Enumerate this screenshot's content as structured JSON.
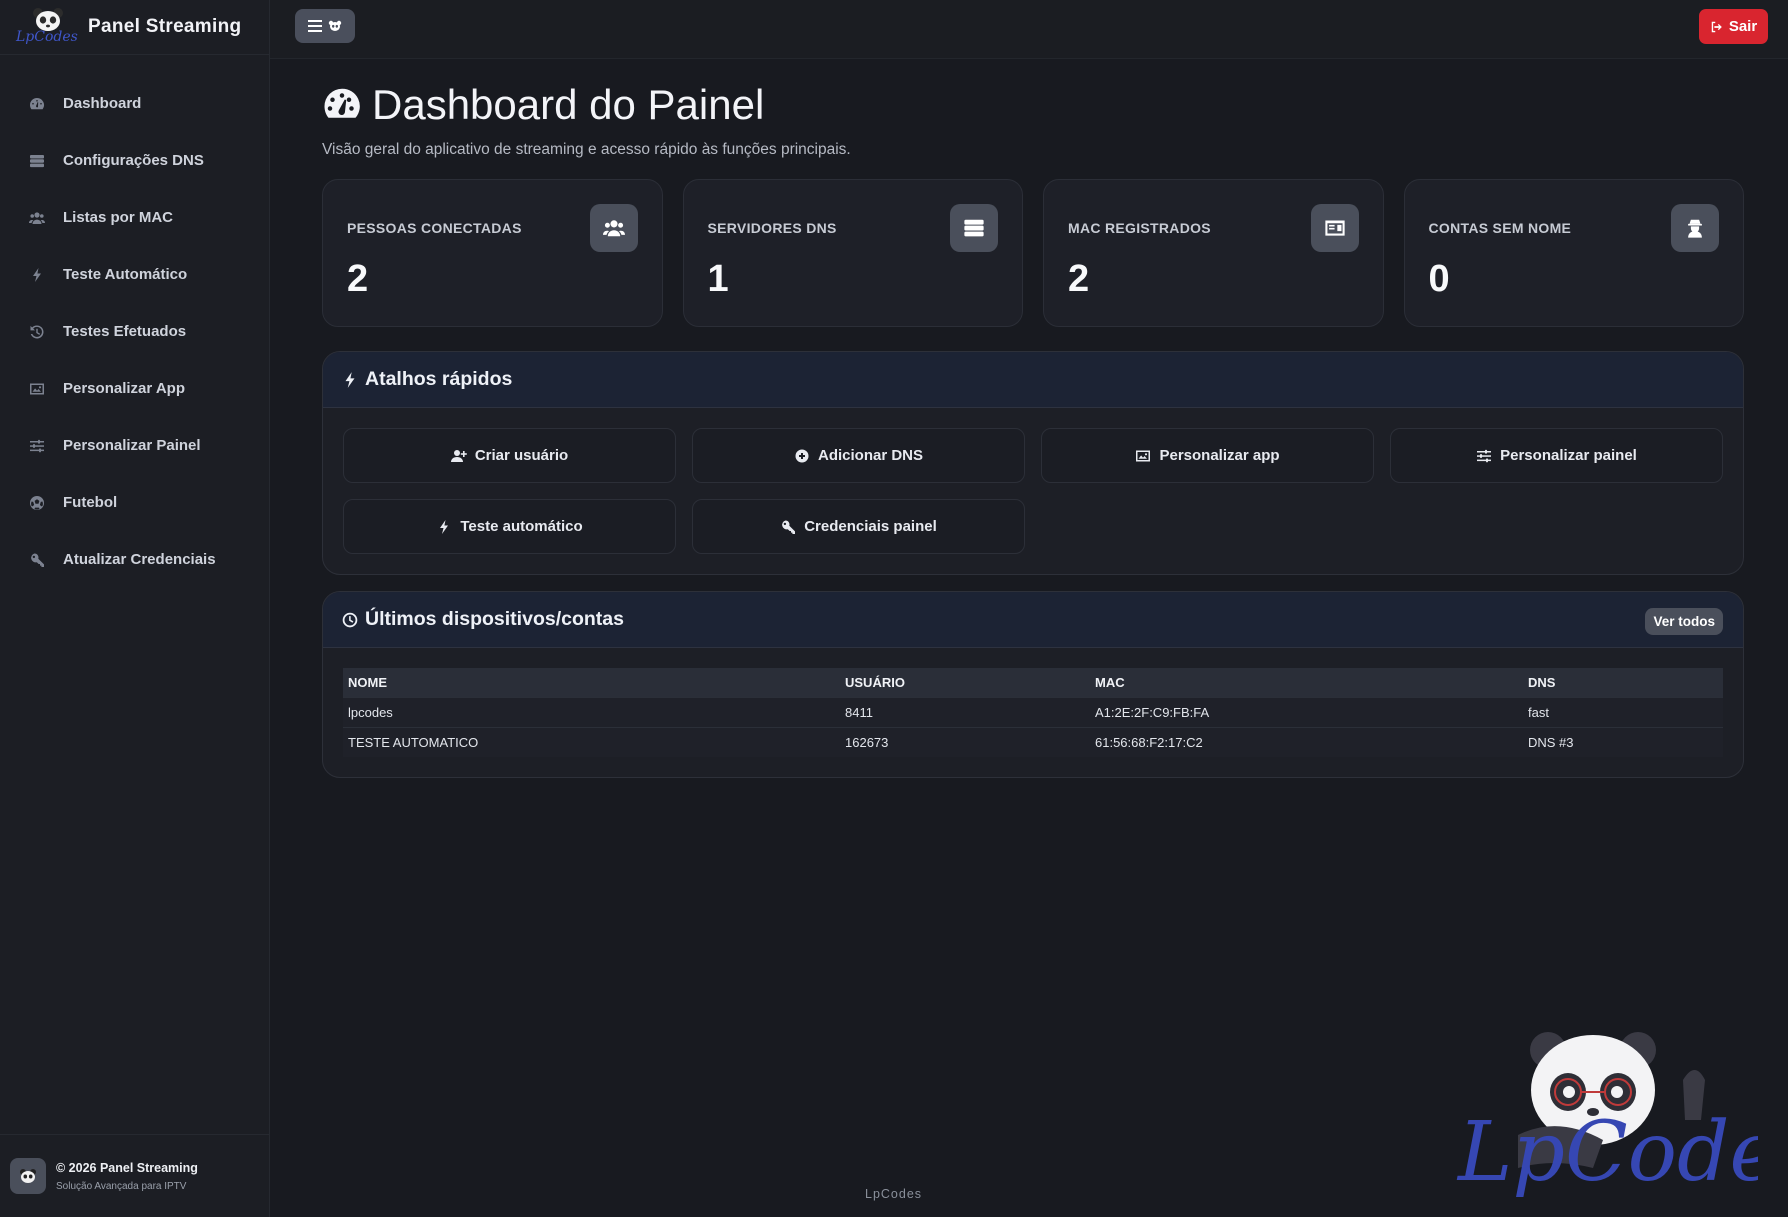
{
  "brand": {
    "logo_text": "LpCodes",
    "title": "Panel Streaming"
  },
  "sidebar": {
    "items": [
      {
        "label": "Dashboard",
        "icon": "gauge-icon"
      },
      {
        "label": "Configurações DNS",
        "icon": "server-icon"
      },
      {
        "label": "Listas por MAC",
        "icon": "users-icon"
      },
      {
        "label": "Teste Automático",
        "icon": "bolt-icon"
      },
      {
        "label": "Testes Efetuados",
        "icon": "history-icon"
      },
      {
        "label": "Personalizar App",
        "icon": "image-icon"
      },
      {
        "label": "Personalizar Painel",
        "icon": "sliders-icon"
      },
      {
        "label": "Futebol",
        "icon": "soccer-ball-icon"
      },
      {
        "label": "Atualizar Credenciais",
        "icon": "key-icon"
      }
    ],
    "footer": {
      "copyright": "© 2026 Panel Streaming",
      "tagline": "Solução Avançada para IPTV"
    }
  },
  "topbar": {
    "logout_label": "Sair"
  },
  "page": {
    "title": "Dashboard do Painel",
    "subtitle": "Visão geral do aplicativo de streaming e acesso rápido às funções principais."
  },
  "stats": [
    {
      "label": "PESSOAS CONECTADAS",
      "value": "2",
      "icon": "users-icon"
    },
    {
      "label": "SERVIDORES DNS",
      "value": "1",
      "icon": "server-icon"
    },
    {
      "label": "MAC REGISTRADOS",
      "value": "2",
      "icon": "id-card-icon"
    },
    {
      "label": "CONTAS SEM NOME",
      "value": "0",
      "icon": "user-secret-icon"
    }
  ],
  "shortcuts": {
    "title": "Atalhos rápidos",
    "items": [
      {
        "label": "Criar usuário",
        "icon": "user-plus-icon"
      },
      {
        "label": "Adicionar DNS",
        "icon": "plus-circle-icon"
      },
      {
        "label": "Personalizar app",
        "icon": "image-icon"
      },
      {
        "label": "Personalizar painel",
        "icon": "sliders-icon"
      },
      {
        "label": "Teste automático",
        "icon": "bolt-icon"
      },
      {
        "label": "Credenciais painel",
        "icon": "key-icon"
      }
    ]
  },
  "devices": {
    "title": "Últimos dispositivos/contas",
    "view_all": "Ver todos",
    "columns": [
      "NOME",
      "USUÁRIO",
      "MAC",
      "DNS"
    ],
    "rows": [
      [
        "lpcodes",
        "8411",
        "A1:2E:2F:C9:FB:FA",
        "fast"
      ],
      [
        "TESTE AUTOMATICO",
        "162673",
        "61:56:68:F2:17:C2",
        "DNS #3"
      ]
    ]
  },
  "footer_brand": "LpCodes",
  "mascot_text": "LpCodes",
  "colors": {
    "accent_danger": "#d9252f",
    "brand_blue": "#3f56c9",
    "card_bg": "#1e2028"
  }
}
